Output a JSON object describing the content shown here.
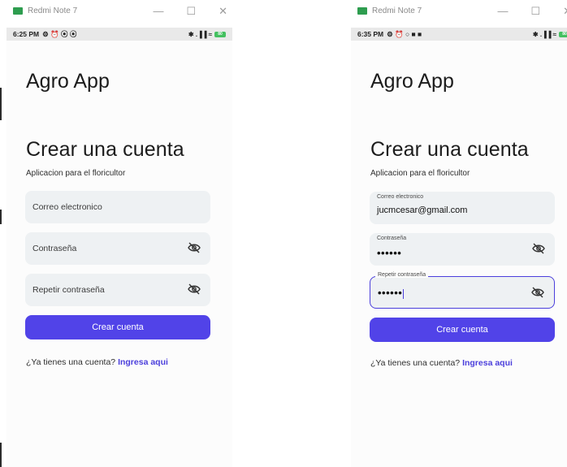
{
  "left": {
    "window_title": "Redmi Note 7",
    "status_time": "6:25 PM",
    "status_icons": "⚙ ⏰ ⦿ ⦿",
    "status_right": "✱ .▐▐ ≈",
    "battery": "80",
    "app_title": "Agro App",
    "heading": "Crear una cuenta",
    "subtitle": "Aplicacion para el floricultor",
    "email_placeholder": "Correo electronico",
    "password_placeholder": "Contraseña",
    "repeat_placeholder": "Repetir contraseña",
    "button_label": "Crear cuenta",
    "footer_text": "¿Ya tienes una cuenta?",
    "footer_link": "Ingresa aqui"
  },
  "right": {
    "window_title": "Redmi Note 7",
    "status_time": "6:35 PM",
    "status_icons": "⚙ ⏰ ○ ■ ■",
    "status_right": "✱ .▐▐ ≈",
    "battery": "80",
    "app_title": "Agro App",
    "heading": "Crear una cuenta",
    "subtitle": "Aplicacion para el floricultor",
    "email_label": "Correo electronico",
    "email_value": "jucmcesar@gmail.com",
    "password_label": "Contraseña",
    "password_value": "••••••",
    "repeat_label": "Repetir contraseña",
    "repeat_value": "••••••",
    "button_label": "Crear cuenta",
    "footer_text": "¿Ya tienes una cuenta?",
    "footer_link": "Ingresa aqui"
  },
  "window_controls": {
    "minimize": "—",
    "maximize": "☐",
    "close": "✕"
  },
  "colors": {
    "accent": "#5143e8",
    "field_bg": "#eef1f3"
  }
}
